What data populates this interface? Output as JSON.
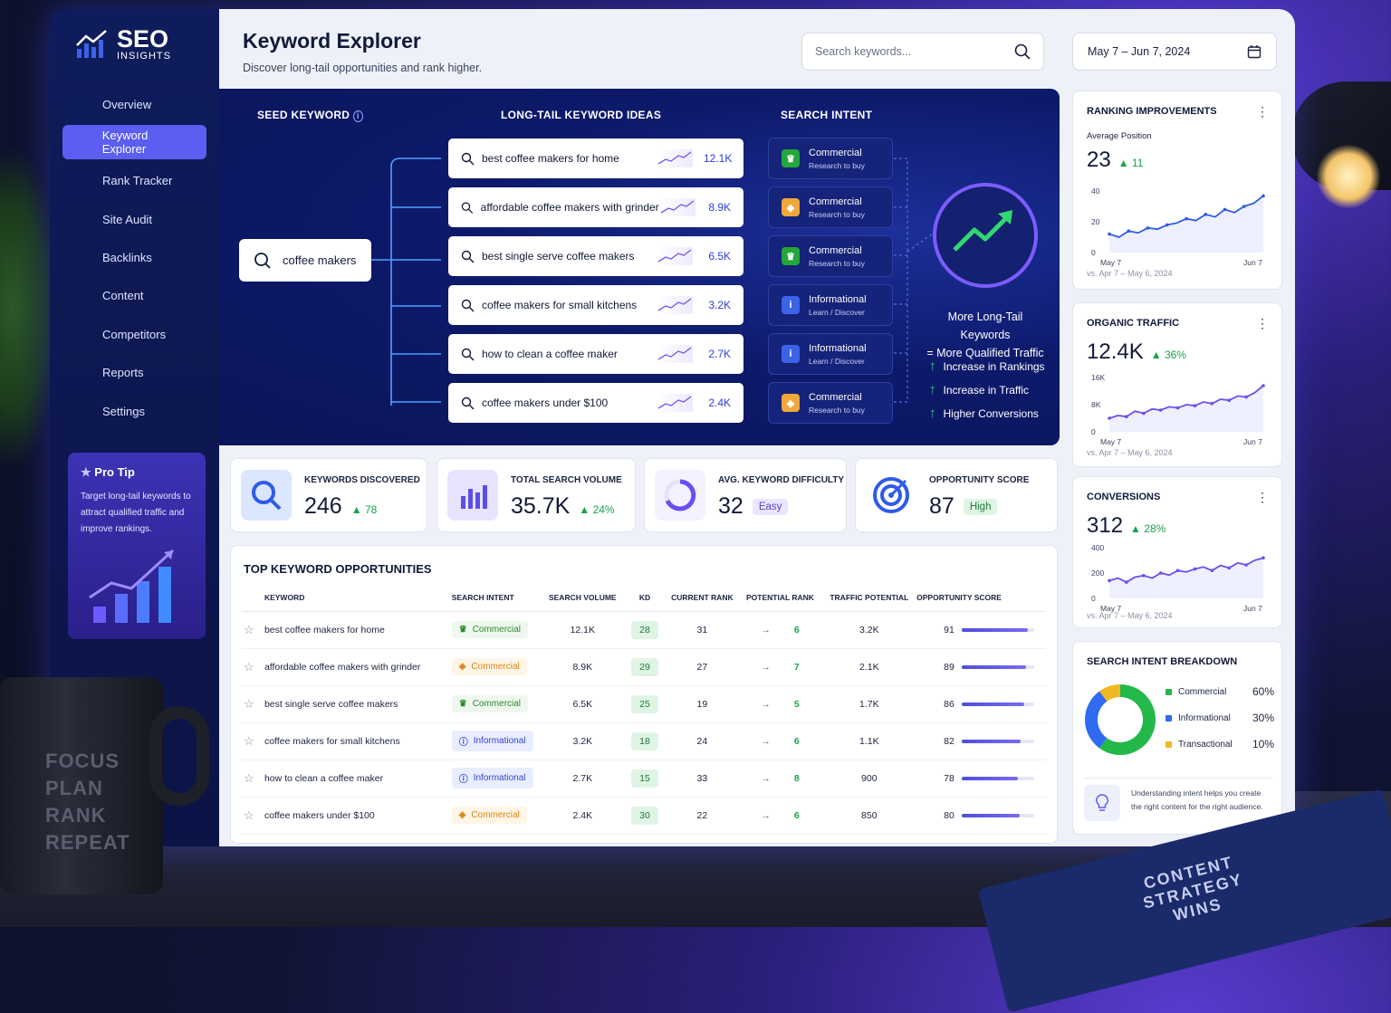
{
  "app": {
    "logo_main": "SEO",
    "logo_sub": "INSIGHTS"
  },
  "nav": [
    {
      "label": "Overview",
      "icon": "home-icon"
    },
    {
      "label": "Keyword Explorer",
      "icon": "search-icon"
    },
    {
      "label": "Rank Tracker",
      "icon": "chart-icon"
    },
    {
      "label": "Site Audit",
      "icon": "clipboard-icon"
    },
    {
      "label": "Backlinks",
      "icon": "link-icon"
    },
    {
      "label": "Content",
      "icon": "document-icon"
    },
    {
      "label": "Competitors",
      "icon": "users-icon"
    },
    {
      "label": "Reports",
      "icon": "bar-chart-icon"
    },
    {
      "label": "Settings",
      "icon": "gear-icon"
    }
  ],
  "protip": {
    "title": "Pro Tip",
    "text": "Target long-tail keywords to attract qualified traffic and improve rankings."
  },
  "header": {
    "title": "Keyword Explorer",
    "subtitle": "Discover long-tail opportunities and rank higher.",
    "search_placeholder": "Search keywords...",
    "date_range": "May 7 – Jun 7, 2024"
  },
  "hero": {
    "seed_caption": "SEED KEYWORD",
    "ideas_caption": "LONG-TAIL KEYWORD IDEAS",
    "intent_caption": "SEARCH INTENT",
    "seed": "coffee makers",
    "ideas": [
      {
        "text": "best coffee makers for home",
        "vol": "12.1K"
      },
      {
        "text": "affordable coffee makers with grinder",
        "vol": "8.9K"
      },
      {
        "text": "best single serve coffee makers",
        "vol": "6.5K"
      },
      {
        "text": "coffee makers for small kitchens",
        "vol": "3.2K"
      },
      {
        "text": "how to clean a coffee maker",
        "vol": "2.7K"
      },
      {
        "text": "coffee makers under $100",
        "vol": "2.4K"
      }
    ],
    "intents": [
      {
        "name": "Commercial",
        "desc": "Research to buy",
        "color": "#22a83a"
      },
      {
        "name": "Commercial",
        "desc": "Research to buy",
        "color": "#f0a83a"
      },
      {
        "name": "Commercial",
        "desc": "Research to buy",
        "color": "#22a83a"
      },
      {
        "name": "Informational",
        "desc": "Learn / Discover",
        "color": "#3b63e8"
      },
      {
        "name": "Informational",
        "desc": "Learn / Discover",
        "color": "#3b63e8"
      },
      {
        "name": "Commercial",
        "desc": "Research to buy",
        "color": "#f0a83a"
      }
    ],
    "headline_1": "More Long-Tail Keywords",
    "headline_2": "= More Qualified Traffic",
    "benefits": [
      "Increase in Rankings",
      "Increase in Traffic",
      "Higher Conversions"
    ]
  },
  "stats": [
    {
      "label": "KEYWORDS DISCOVERED",
      "value": "246",
      "change": "78"
    },
    {
      "label": "TOTAL SEARCH VOLUME",
      "value": "35.7K",
      "change": "24%"
    },
    {
      "label": "AVG. KEYWORD DIFFICULTY",
      "value": "32",
      "badge": "Easy"
    },
    {
      "label": "OPPORTUNITY SCORE",
      "value": "87",
      "badge": "High"
    }
  ],
  "table": {
    "title": "TOP KEYWORD OPPORTUNITIES",
    "columns": [
      "KEYWORD",
      "SEARCH INTENT",
      "SEARCH VOLUME",
      "KD",
      "CURRENT RANK",
      "POTENTIAL RANK",
      "TRAFFIC POTENTIAL",
      "OPPORTUNITY SCORE"
    ],
    "rows": [
      {
        "kw": "best coffee makers for home",
        "intent": "Commercial",
        "kind": "c",
        "vol": "12.1K",
        "kd": "28",
        "cur": "31",
        "pot": "6",
        "traffic": "3.2K",
        "score": 91
      },
      {
        "kw": "affordable coffee makers with grinder",
        "intent": "Commercial",
        "kind": "co",
        "vol": "8.9K",
        "kd": "29",
        "cur": "27",
        "pot": "7",
        "traffic": "2.1K",
        "score": 89
      },
      {
        "kw": "best single serve coffee makers",
        "intent": "Commercial",
        "kind": "c",
        "vol": "6.5K",
        "kd": "25",
        "cur": "19",
        "pot": "5",
        "traffic": "1.7K",
        "score": 86
      },
      {
        "kw": "coffee makers for small kitchens",
        "intent": "Informational",
        "kind": "i",
        "vol": "3.2K",
        "kd": "18",
        "cur": "24",
        "pot": "6",
        "traffic": "1.1K",
        "score": 82
      },
      {
        "kw": "how to clean a coffee maker",
        "intent": "Informational",
        "kind": "i",
        "vol": "2.7K",
        "kd": "15",
        "cur": "33",
        "pot": "8",
        "traffic": "900",
        "score": 78
      },
      {
        "kw": "coffee makers under $100",
        "intent": "Commercial",
        "kind": "co",
        "vol": "2.4K",
        "kd": "30",
        "cur": "22",
        "pot": "6",
        "traffic": "850",
        "score": 80
      }
    ]
  },
  "rank_card": {
    "title": "RANKING IMPROVEMENTS",
    "sub": "Average Position",
    "value": "23",
    "change": "11",
    "y_ticks": [
      "40",
      "20",
      "0"
    ],
    "x_start": "May 7",
    "x_end": "Jun 7",
    "footer": "vs. Apr 7 – May 6, 2024"
  },
  "traffic_card": {
    "title": "ORGANIC TRAFFIC",
    "value": "12.4K",
    "change": "36%",
    "y_ticks": [
      "16K",
      "8K",
      "0"
    ],
    "x_start": "May 7",
    "x_end": "Jun 7",
    "footer": "vs. Apr 7 – May 6, 2024"
  },
  "conv_card": {
    "title": "CONVERSIONS",
    "value": "312",
    "change": "28%",
    "y_ticks": [
      "400",
      "200",
      "0"
    ],
    "x_start": "May 7",
    "x_end": "Jun 7",
    "footer": "vs. Apr 7 – May 6, 2024"
  },
  "intent_card": {
    "title": "SEARCH INTENT BREAKDOWN",
    "items": [
      {
        "label": "Commercial",
        "pct": "60%",
        "color": "#22b84a",
        "value": 60
      },
      {
        "label": "Informational",
        "pct": "30%",
        "color": "#2f6bf0",
        "value": 30
      },
      {
        "label": "Transactional",
        "pct": "10%",
        "color": "#f2b824",
        "value": 10
      }
    ],
    "note": "Understanding intent helps you create the right content for the right audience."
  },
  "decor": {
    "mug": [
      "FOCUS",
      "PLAN",
      "RANK",
      "REPEAT"
    ],
    "notebook": [
      "CONTENT",
      "STRATEGY",
      "WINS"
    ]
  }
}
